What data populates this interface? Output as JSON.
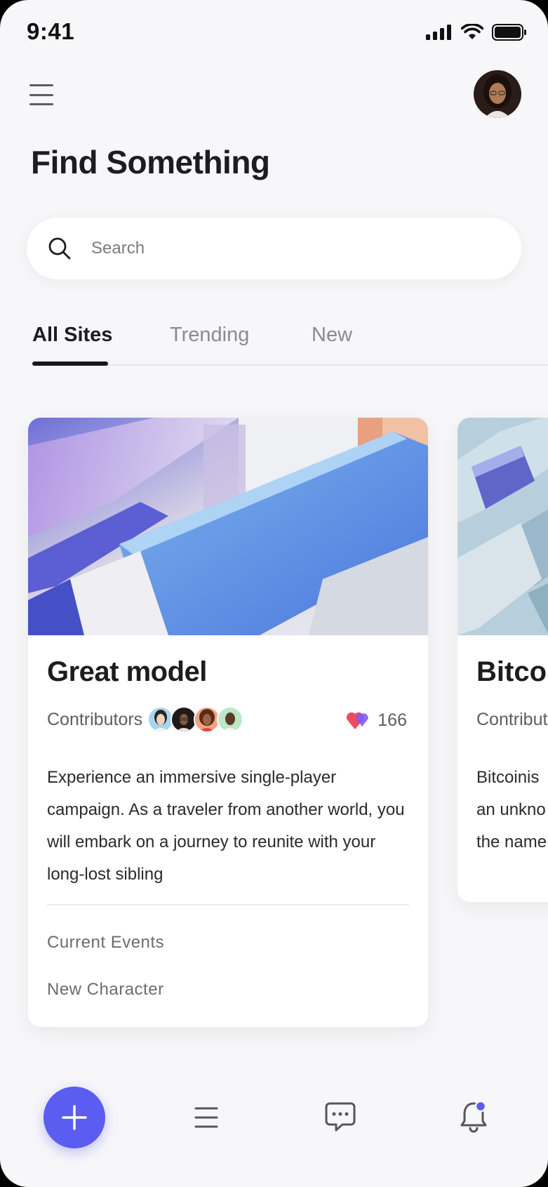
{
  "status_bar": {
    "time": "9:41"
  },
  "header": {
    "title": "Find Something"
  },
  "search": {
    "placeholder": "Search"
  },
  "tabs": [
    {
      "label": "All Sites",
      "active": true
    },
    {
      "label": "Trending",
      "active": false
    },
    {
      "label": "New",
      "active": false
    }
  ],
  "cards": [
    {
      "title": "Great model",
      "contributors_label": "Contributors",
      "likes": "166",
      "description": "Experience an immersive single-player campaign. As a traveler from another world, you will embark on a journey to reunite with your long-lost sibling",
      "links": [
        "Current Events",
        "New Character"
      ]
    },
    {
      "title": "Bitcoi",
      "contributors_label": "Contributo",
      "description_lines": [
        "Bitcoinis",
        "an unkno",
        "the name"
      ]
    }
  ],
  "colors": {
    "accent": "#5b5cf0",
    "background": "#f7f7f9",
    "card": "#ffffff",
    "heart_red": "#ef4b5f",
    "heart_purple": "#7d5cf2"
  },
  "bottom_nav": {
    "icons": [
      "plus-icon",
      "list-icon",
      "chat-icon",
      "bell-icon"
    ],
    "notification_dot_color": "#5b5cf0"
  }
}
